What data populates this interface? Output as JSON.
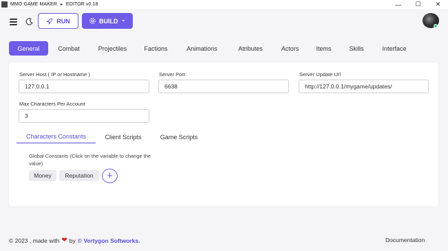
{
  "window": {
    "title": "MMO GAME MAKER",
    "separator": "▸",
    "editor_label": "EDITOR v0.18",
    "controls": {
      "minimize": "—",
      "maximize": "☐",
      "close": "✕"
    }
  },
  "toolbar": {
    "run_label": "RUN",
    "build_label": "BUILD",
    "build_caret": "⌄"
  },
  "main_tabs": [
    {
      "label": "General",
      "active": true
    },
    {
      "label": "Combat",
      "active": false
    },
    {
      "label": "Projectiles",
      "active": false
    },
    {
      "label": "Factions",
      "active": false
    },
    {
      "label": "Animations",
      "active": false
    },
    {
      "label": "Atributes",
      "active": false
    },
    {
      "label": "Actors",
      "active": false
    },
    {
      "label": "Items",
      "active": false
    },
    {
      "label": "Skills",
      "active": false
    },
    {
      "label": "Interface",
      "active": false
    }
  ],
  "fields": {
    "server_host": {
      "label": "Server Host ( IP or Hostname )",
      "value": "127.0.0.1"
    },
    "server_port": {
      "label": "Server Port",
      "value": "6638"
    },
    "server_update_url": {
      "label": "Server Update Url",
      "value": "http://127.0.0.1/mygame/updates/"
    },
    "max_characters": {
      "label": "Max Characters Per Account",
      "value": "3"
    }
  },
  "sub_tabs": [
    {
      "label": "Characters Constants",
      "active": true
    },
    {
      "label": "Client Scripts",
      "active": false
    },
    {
      "label": "Game Scripts",
      "active": false
    }
  ],
  "constants": {
    "description": "Global Constants (Click on the variable to change the value)",
    "items": [
      "Money",
      "Reputation"
    ],
    "add_label": "+"
  },
  "footer": {
    "copyright": "© 2023 , made with",
    "heart": "❤",
    "by": "by",
    "company": "© Vertygon Softworks.",
    "documentation": "Documentation"
  },
  "colors": {
    "accent": "#6c5ce7",
    "accent_text": "#5a4fd0",
    "heart": "#e0242c",
    "online_status": "#2ecc71"
  }
}
